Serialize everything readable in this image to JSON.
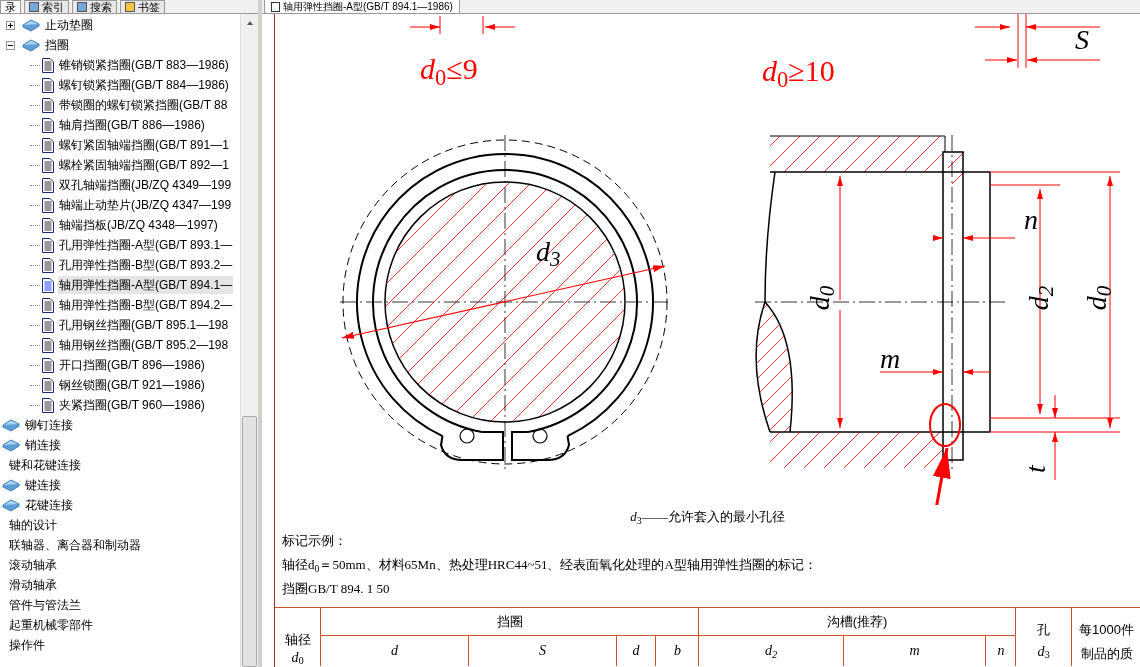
{
  "nav_tabs": [
    {
      "label": "录",
      "selected": true
    },
    {
      "label": "索引",
      "selected": false
    },
    {
      "label": "搜索",
      "selected": false
    },
    {
      "label": "书签",
      "selected": false
    }
  ],
  "tree": [
    {
      "children": [
        {
          "label": "止动垫圈",
          "kind": "book",
          "expanded": false
        },
        {
          "label": "挡圈",
          "kind": "book",
          "expanded": true,
          "children": [
            {
              "label": "锥销锁紧挡圈(GB/T 883—1986)",
              "kind": "page",
              "selected": false
            },
            {
              "label": "螺钉锁紧挡圈(GB/T 884—1986)",
              "kind": "page",
              "selected": false
            },
            {
              "label": "带锁圈的螺钉锁紧挡圈(GB/T 88",
              "kind": "page",
              "selected": false
            },
            {
              "label": "轴肩挡圈(GB/T 886—1986)",
              "kind": "page",
              "selected": false
            },
            {
              "label": "螺钉紧固轴端挡圈(GB/T 891—1",
              "kind": "page",
              "selected": false
            },
            {
              "label": "螺栓紧固轴端挡圈(GB/T 892—1",
              "kind": "page",
              "selected": false
            },
            {
              "label": "双孔轴端挡圈(JB/ZQ 4349—199",
              "kind": "page",
              "selected": false
            },
            {
              "label": "轴端止动垫片(JB/ZQ 4347—199",
              "kind": "page",
              "selected": false
            },
            {
              "label": "轴端挡板(JB/ZQ 4348—1997)",
              "kind": "page",
              "selected": false
            },
            {
              "label": "孔用弹性挡圈-A型(GB/T 893.1—",
              "kind": "page",
              "selected": false
            },
            {
              "label": "孔用弹性挡圈-B型(GB/T 893.2—",
              "kind": "page",
              "selected": false
            },
            {
              "label": "轴用弹性挡圈-A型(GB/T 894.1—",
              "kind": "page",
              "selected": true
            },
            {
              "label": "轴用弹性挡圈-B型(GB/T 894.2—",
              "kind": "page",
              "selected": false
            },
            {
              "label": "孔用钢丝挡圈(GB/T 895.1—198",
              "kind": "page",
              "selected": false
            },
            {
              "label": "轴用钢丝挡圈(GB/T 895.2—198",
              "kind": "page",
              "selected": false
            },
            {
              "label": "开口挡圈(GB/T 896—1986)",
              "kind": "page",
              "selected": false
            },
            {
              "label": "钢丝锁圈(GB/T 921—1986)",
              "kind": "page",
              "selected": false
            },
            {
              "label": "夹紧挡圈(GB/T 960—1986)",
              "kind": "page",
              "selected": false
            }
          ]
        }
      ]
    },
    {
      "label": "铆钉连接",
      "kind": "book"
    },
    {
      "label": "销连接",
      "kind": "book"
    },
    {
      "label": "键和花键连接",
      "kind": "plain"
    },
    {
      "label": "键连接",
      "kind": "book"
    },
    {
      "label": "花键连接",
      "kind": "book"
    },
    {
      "label": "轴的设计",
      "kind": "plain"
    },
    {
      "label": "联轴器、离合器和制动器",
      "kind": "plain"
    },
    {
      "label": "滚动轴承",
      "kind": "plain"
    },
    {
      "label": "滑动轴承",
      "kind": "plain"
    },
    {
      "label": "管件与管法兰",
      "kind": "plain"
    },
    {
      "label": "起重机械零部件",
      "kind": "plain"
    },
    {
      "label": "操作件",
      "kind": "plain"
    }
  ],
  "document_tab": {
    "title": "轴用弹性挡圈-A型(GB/T 894.1—1986)"
  },
  "drawing": {
    "labels": [
      {
        "text": "*d*$_{0}$≤9",
        "kind": "condition"
      },
      {
        "text": "*d*$_{0}$≥10",
        "kind": "condition"
      },
      {
        "text": "S",
        "kind": "dimension"
      },
      {
        "text": "d$_{3}$",
        "kind": "dimension"
      },
      {
        "text": "d$_{0}$",
        "kind": "dimension"
      },
      {
        "text": "n",
        "kind": "dimension"
      },
      {
        "text": "d$_{2}$",
        "kind": "dimension"
      },
      {
        "text": "d$_{0}$",
        "kind": "dimension"
      },
      {
        "text": "m",
        "kind": "dimension"
      },
      {
        "text": "t",
        "kind": "dimension"
      }
    ]
  },
  "caption": "*d*$_{3}$——允许套入的最小孔径",
  "notes": [
    "标记示例：",
    "轴径d$_{0}$＝50mm、材料65Mn、热处理HRC44~51、经表面氧化处理的A型轴用弹性挡圈的标记：",
    "挡圈GB/T 894. 1 50"
  ],
  "table": {
    "row_header": [
      "轴径",
      "*d*$_{0}$"
    ],
    "groups": [
      {
        "title": "挡圈",
        "columns": [
          "*d*",
          "*S*",
          "*d*",
          "*b*"
        ]
      },
      {
        "title": "沟槽(推荐)",
        "columns": [
          "*d*$_{2}$",
          "*m*",
          "*n*"
        ]
      }
    ],
    "side_columns": [
      [
        "孔",
        "*d*$_{3}$"
      ],
      [
        "每1000件",
        "制品的质"
      ]
    ]
  }
}
